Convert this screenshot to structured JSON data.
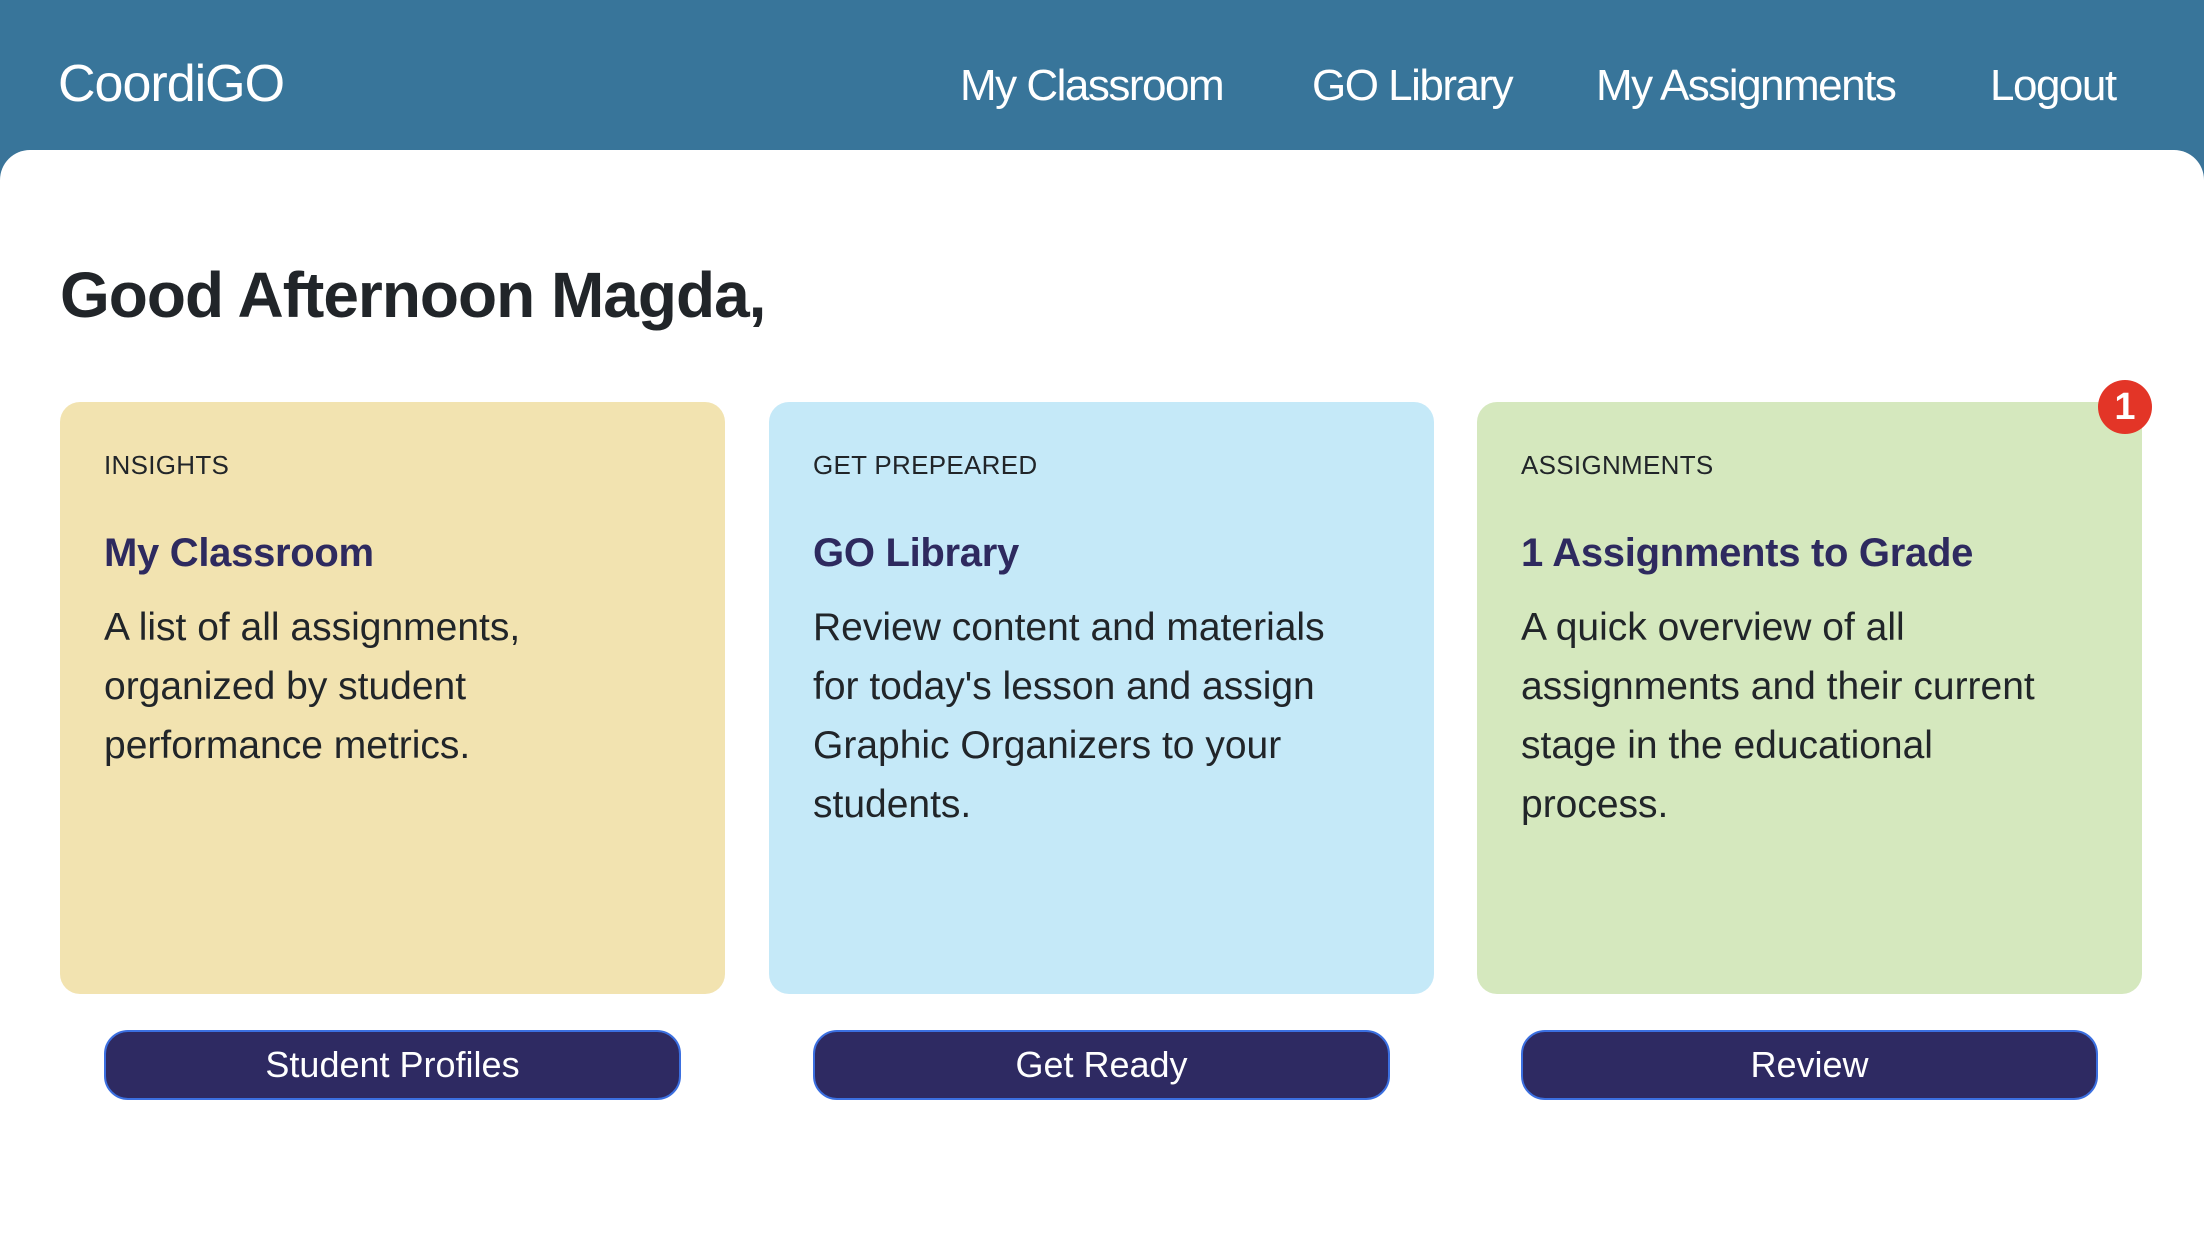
{
  "app": {
    "title": "CoordiGO"
  },
  "nav": {
    "items": [
      {
        "label": "My Classroom"
      },
      {
        "label": "GO Library"
      },
      {
        "label": "My Assignments"
      },
      {
        "label": "Logout"
      }
    ]
  },
  "main": {
    "greeting": "Good Afternoon Magda,",
    "cards": [
      {
        "label": "INSIGHTS",
        "title": "My Classroom",
        "body": "A list of all assignments, organized by student performance metrics.",
        "button": "Student Profiles",
        "color": "#f2e3b0"
      },
      {
        "label": "GET PREPEARED",
        "title": "GO Library",
        "body": "Review content and materials for today's lesson and assign Graphic Organizers to your students.",
        "button": "Get Ready",
        "color": "#c5e9f8"
      },
      {
        "label": "ASSIGNMENTS",
        "title": "1 Assignments to Grade",
        "body": "A quick overview of all assignments and their current stage in the educational process.",
        "button": "Review",
        "color": "#d5e8be",
        "badge": "1"
      }
    ]
  },
  "colors": {
    "header": "#38759a",
    "accent_title": "#2e2a5f",
    "button_bg": "#2e2a62",
    "button_border": "#3b6fe0",
    "badge": "#e33527"
  }
}
